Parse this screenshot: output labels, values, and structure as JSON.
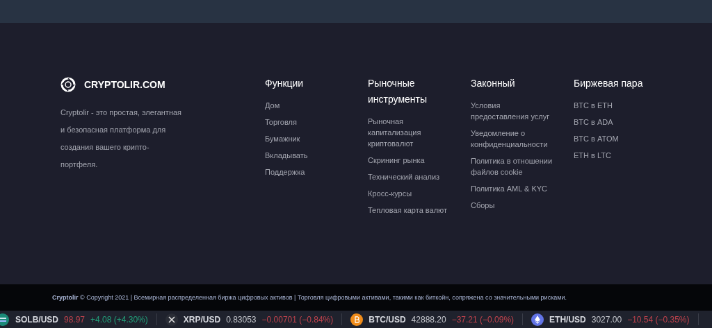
{
  "brand": {
    "name": "CRYPTOLIR.COM",
    "description": "Cryptolir - это простая, элегантная и безопасная платформа для создания вашего крипто-портфеля."
  },
  "columns": [
    {
      "title": "Функции",
      "links": [
        "Дом",
        "Торговля",
        "Бумажник",
        "Вкладывать",
        "Поддержка"
      ]
    },
    {
      "title": "Рыночные инструменты",
      "links": [
        "Рыночная капитализация криптовалют",
        "Скрининг рынка",
        "Технический анализ",
        "Кросс-курсы",
        "Тепловая карта валют"
      ]
    },
    {
      "title": "Законный",
      "links": [
        "Условия предоставления услуг",
        "Уведомление о конфиденциальности",
        "Политика в отношении файлов cookie",
        "Политика AML & KYC",
        "Сборы"
      ]
    },
    {
      "title": "Биржевая пара",
      "links": [
        "BTC в ETH",
        "BTC в ADA",
        "BTC в ATOM",
        "ETH в LTC"
      ]
    }
  ],
  "copyright": "**Cryptolir** © Copyright 2021 | Всемирная распределенная биржа цифровых активов | Торговля цифровыми активами, такими как биткойн, сопряжена со значительными рисками.",
  "ticker": [
    {
      "kind": "stack",
      "pair": "SOLB/USD",
      "price": "98.97",
      "price_down": true,
      "change": "+4.08 (+4.30%)",
      "rising": true
    },
    {
      "kind": "cross",
      "pair": "XRP/USD",
      "price": "0.83053",
      "price_down": false,
      "change": "−0.00701 (−0.84%)",
      "rising": false
    },
    {
      "kind": "bitcoin",
      "pair": "BTC/USD",
      "price": "42888.20",
      "price_down": false,
      "change": "−37.21 (−0.09%)",
      "rising": false
    },
    {
      "kind": "diamond",
      "pair": "ETH/USD",
      "price": "3027.00",
      "price_down": false,
      "change": "−10.54 (−0.35%)",
      "rising": false
    }
  ]
}
